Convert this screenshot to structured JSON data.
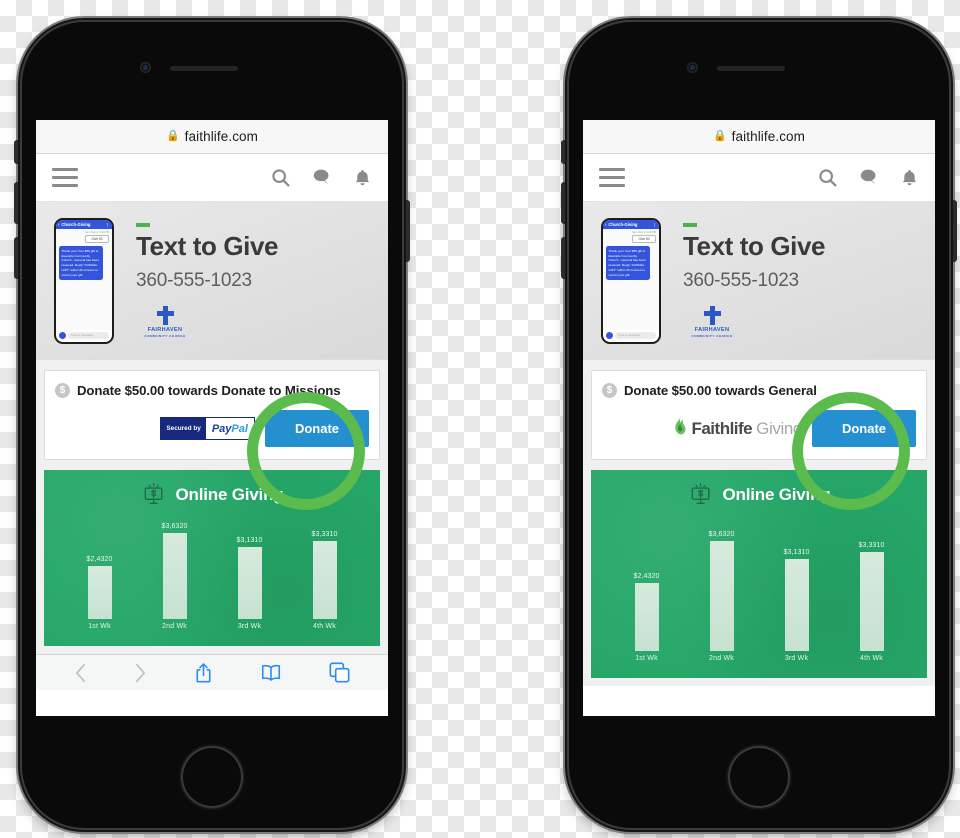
{
  "browser": {
    "url": "faithlife.com",
    "lock_icon": "lock-icon"
  },
  "site_nav": {
    "menu_icon": "hamburger-menu-icon",
    "search_icon": "search-icon",
    "chat_icon": "chat-bubble-icon",
    "bell_icon": "notification-bell-icon"
  },
  "hero": {
    "title": "Text to Give",
    "phone_number": "360-555-1023",
    "church_logo": {
      "icon": "cross-icon",
      "name": "FAIRHAVEN",
      "subtitle": "COMMUNITY CHURCH"
    },
    "sms_mockup": {
      "conversation_title": "Church-Giving",
      "back_icon": "chevron-left-icon",
      "overflow_icon": "more-vertical-icon",
      "timestamp": "Sun, Nov 4, 9:23 PM",
      "outgoing_message": "Give 50",
      "incoming_message": "Thank you! Your $50 gift to Example Community Church - General has been received. Reply \"CANCEL GIFT\" within 30 minutes to cancel your gift.",
      "compose_placeholder": "Type a message..."
    }
  },
  "left_phone": {
    "donate": {
      "dollar_icon": "dollar-badge-icon",
      "label": "Donate $50.00 towards Donate to Missions",
      "payment_badge": {
        "secured_by": "Secured by",
        "brand_pay": "Pay",
        "brand_pal": "Pal"
      },
      "button_label": "Donate"
    },
    "safari_toolbar": {
      "back_icon": "chevron-left-icon",
      "forward_icon": "chevron-right-icon",
      "share_icon": "share-icon",
      "bookmarks_icon": "book-icon",
      "tabs_icon": "tabs-icon"
    }
  },
  "right_phone": {
    "donate": {
      "dollar_icon": "dollar-badge-icon",
      "label": "Donate $50.00 towards General",
      "payment_badge": {
        "flame_icon": "faithlife-flame-icon",
        "brand_name": "Faithlife",
        "brand_product": "Giving"
      },
      "button_label": "Donate"
    }
  },
  "annotations": {
    "highlight_color": "#5cbb4d",
    "targets": [
      "donate-button-left",
      "donate-button-right"
    ]
  },
  "colors": {
    "donate_button": "#2590d0",
    "chart_background": "#25a768",
    "annotation_green": "#5cbb4d",
    "paypal_navy": "#17287e",
    "church_blue": "#2b59c3"
  },
  "chart_data": {
    "type": "bar",
    "title": "Online Giving",
    "icon": "monitor-dollar-icon",
    "categories": [
      "1st Wk",
      "2nd Wk",
      "3rd Wk",
      "4th Wk"
    ],
    "values": [
      24320,
      36320,
      31310,
      33310
    ],
    "value_labels": [
      "$2,4320",
      "$3,6320",
      "$3,1310",
      "$3,3310"
    ],
    "xlabel": "",
    "ylabel": "",
    "ylim": [
      0,
      40000
    ],
    "grid": false,
    "legend": "none"
  }
}
